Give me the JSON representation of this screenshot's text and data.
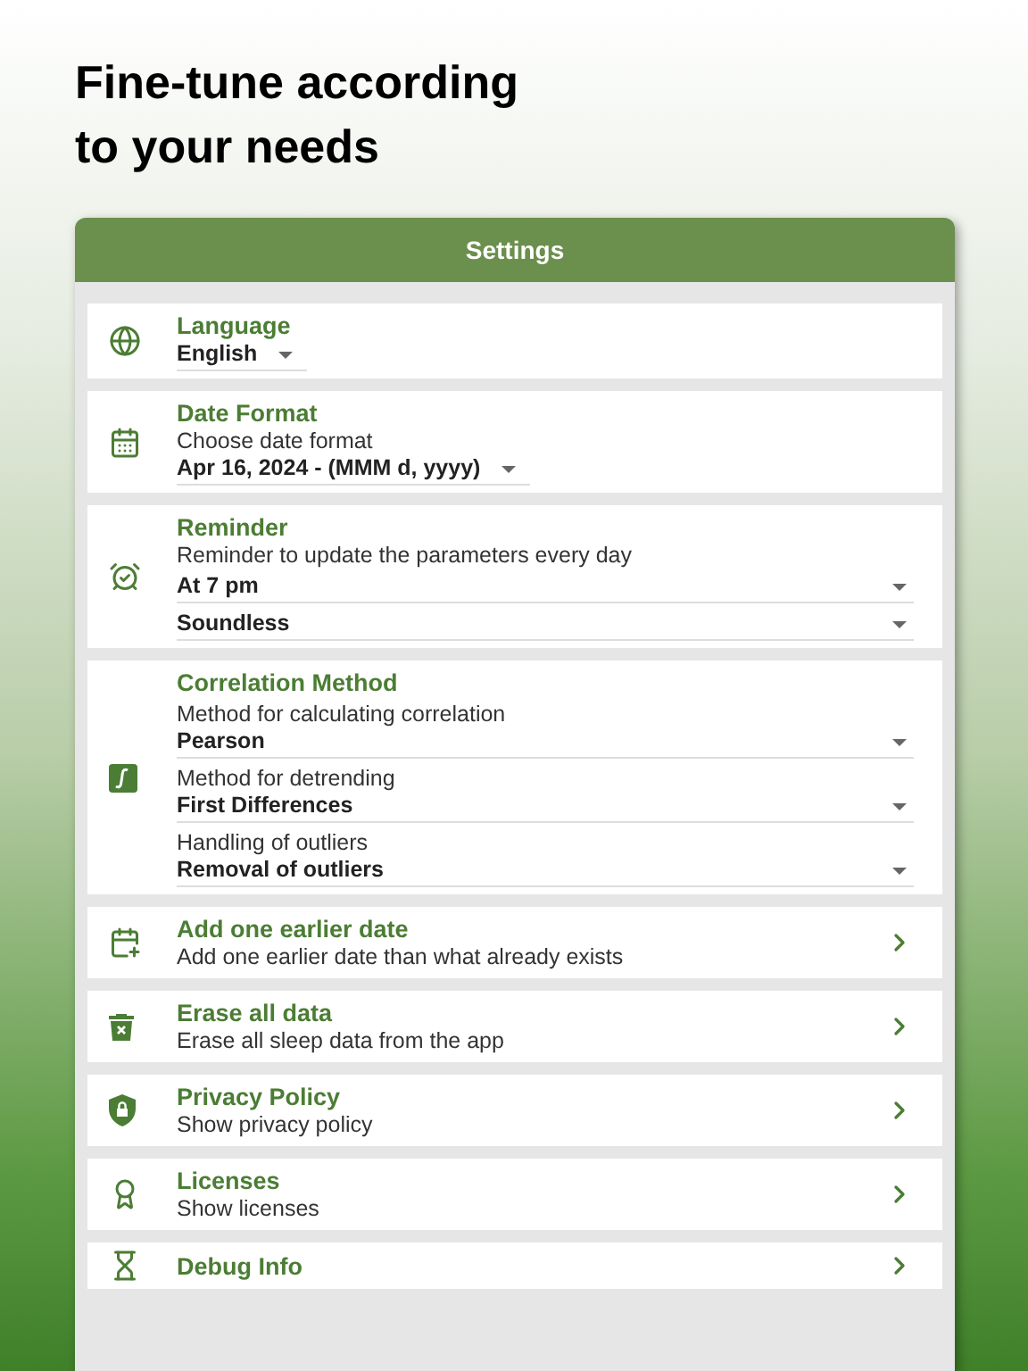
{
  "headline": [
    "Fine-tune according",
    "to your needs"
  ],
  "header": {
    "title": "Settings"
  },
  "sections": [
    {
      "kind": "inline",
      "title": "Language",
      "selects": [
        {
          "value": "English"
        }
      ]
    },
    {
      "kind": "inline",
      "title": "Date Format",
      "subtitle": "Choose date format",
      "selects": [
        {
          "value": "Apr 16, 2024 - (MMM d, yyyy)"
        }
      ]
    },
    {
      "kind": "full",
      "title": "Reminder",
      "subtitle": "Reminder to update the parameters every day",
      "selects": [
        {
          "value": "At 7 pm"
        },
        {
          "value": "Soundless"
        }
      ]
    },
    {
      "kind": "full",
      "title": "Correlation Method",
      "selects": [
        {
          "label": "Method for calculating correlation",
          "value": "Pearson"
        },
        {
          "label": "Method for detrending",
          "value": "First Differences"
        },
        {
          "label": "Handling of outliers",
          "value": "Removal of outliers"
        }
      ]
    },
    {
      "kind": "link",
      "title": "Add one earlier date",
      "subtitle": "Add one earlier date than what already exists"
    },
    {
      "kind": "link",
      "title": "Erase all data",
      "subtitle": "Erase all sleep data from the app"
    },
    {
      "kind": "link",
      "title": "Privacy Policy",
      "subtitle": "Show privacy policy"
    },
    {
      "kind": "link",
      "title": "Licenses",
      "subtitle": "Show licenses"
    },
    {
      "kind": "link",
      "title": "Debug Info"
    }
  ]
}
